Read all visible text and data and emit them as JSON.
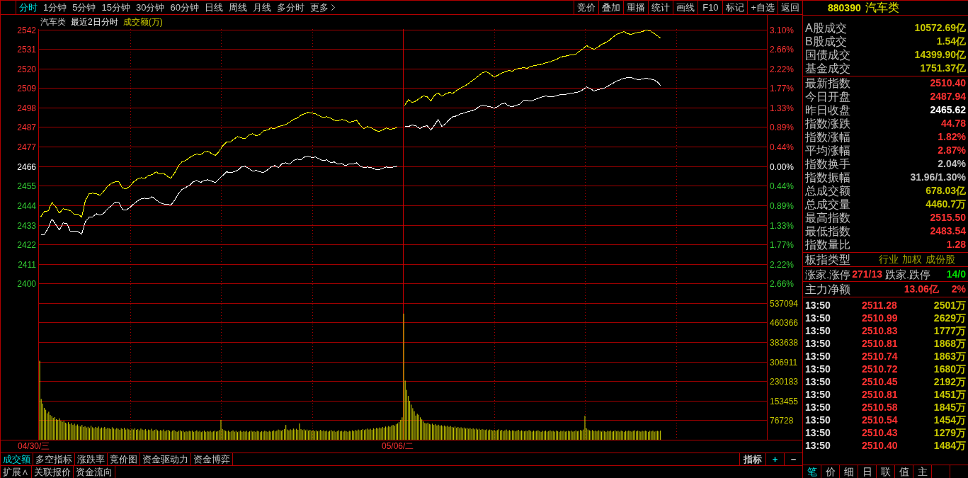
{
  "toolbar": {
    "periods": [
      {
        "label": "分时",
        "selected": true
      },
      {
        "label": "1分钟",
        "selected": false
      },
      {
        "label": "5分钟",
        "selected": false
      },
      {
        "label": "15分钟",
        "selected": false
      },
      {
        "label": "30分钟",
        "selected": false
      },
      {
        "label": "60分钟",
        "selected": false
      },
      {
        "label": "日线",
        "selected": false
      },
      {
        "label": "周线",
        "selected": false
      },
      {
        "label": "月线",
        "selected": false
      },
      {
        "label": "多分时",
        "selected": false
      }
    ],
    "more": "更多",
    "tools": [
      "竞价",
      "叠加",
      "重播",
      "统计",
      "画线",
      "F10",
      "标记",
      "+自选",
      "返回"
    ]
  },
  "chart": {
    "header": {
      "name": "汽车类",
      "mode": "最近2日分时",
      "indicator": "成交额(万)"
    },
    "price_chart": {
      "chart_data": {
        "type": "line",
        "grid": true,
        "categories": [
          null,
          null,
          null,
          null,
          null,
          null,
          null,
          null,
          null,
          null,
          null,
          null,
          null,
          null,
          null,
          null,
          null,
          null,
          null,
          null,
          null,
          null,
          null,
          null,
          null,
          null,
          null,
          null,
          null,
          null,
          null,
          null,
          null,
          null,
          null,
          null,
          null,
          null,
          null,
          null,
          null,
          null,
          null,
          null,
          null,
          null,
          null,
          null,
          null,
          null,
          null,
          null,
          null,
          null,
          null,
          null,
          null,
          null,
          null,
          null,
          null,
          null,
          null,
          null,
          null,
          null,
          null,
          null,
          null,
          null,
          null,
          null,
          null,
          null,
          null,
          null,
          null,
          null,
          null,
          null,
          null,
          null,
          null,
          null,
          null,
          null,
          null,
          null,
          null,
          null,
          null,
          null,
          null,
          null,
          null,
          null,
          null,
          null,
          null,
          null,
          null,
          null,
          null,
          null,
          null,
          null,
          null,
          null,
          null,
          null,
          null,
          null,
          null,
          null,
          null,
          null,
          null,
          null,
          null,
          null,
          null,
          null,
          null,
          null,
          null,
          null,
          null,
          null,
          null,
          null,
          null,
          null,
          null,
          null,
          null,
          null,
          null,
          null,
          null,
          null,
          null,
          null,
          null,
          null,
          null,
          null,
          null,
          null,
          null,
          null,
          null,
          null,
          null,
          null,
          null,
          null,
          null,
          null,
          null,
          null,
          null,
          null,
          null,
          null,
          null,
          null,
          null,
          null,
          null,
          null,
          null,
          null,
          null,
          null,
          null,
          null,
          null,
          null,
          null,
          null,
          null,
          null,
          null,
          null,
          null,
          null,
          null,
          null,
          null,
          null,
          null,
          null,
          null,
          null,
          null,
          null
        ],
        "series": [
          {
            "color": "#ffffff",
            "values": [
              2427.6,
              2427.6,
              2431.2,
              2436.3,
              2433.2,
              2430.0,
              2434.0,
              2433.6,
              2429.2,
              2429.2,
              2429.2,
              2427.6,
              2434.8,
              2437.1,
              2437.5,
              2439.1,
              2438.3,
              2439.5,
              2441.9,
              2443.5,
              2445.4,
              2445.4,
              2441.5,
              2441.1,
              2442.7,
              2444.6,
              2446.2,
              2447.4,
              2447.8,
              2447.4,
              2448.6,
              2447.0,
              2445.4,
              2444.6,
              2444.6,
              2443.9,
              2446.6,
              2450.2,
              2452.6,
              2453.8,
              2454.9,
              2456.9,
              2457.7,
              2456.5,
              2457.7,
              2458.1,
              2457.3,
              2456.5,
              2458.5,
              2460.5,
              2462.5,
              2462.1,
              2462.5,
              2463.3,
              2465.2,
              2465.6,
              2464.4,
              2462.9,
              2463.3,
              2462.5,
              2462.1,
              2463.6,
              2465.2,
              2466.0,
              2464.8,
              2467.2,
              2467.6,
              2466.8,
              2468.8,
              2469.6,
              2469.2,
              2470.8,
              2471.2,
              2470.4,
              2470.8,
              2469.6,
              2468.8,
              2469.2,
              2467.6,
              2468.0,
              2466.8,
              2467.2,
              2466.0,
              2466.8,
              2466.8,
              2467.6,
              2465.6,
              2464.8,
              2465.2,
              2464.8,
              2464.0,
              2463.6,
              2464.4,
              2465.2,
              2464.8,
              2465.2,
              2465.6,
              null,
              2487.8,
              2487.8,
              2488.6,
              2488.2,
              2486.6,
              2487.8,
              2488.2,
              2485.8,
              2488.6,
              2491.7,
              2487.8,
              2489.4,
              2491.7,
              2493.3,
              2493.7,
              2494.9,
              2495.3,
              2496.1,
              2496.5,
              2497.3,
              2498.9,
              2499.6,
              2499.2,
              2498.9,
              2498.1,
              2498.9,
              2500.4,
              2500.8,
              2499.2,
              2498.9,
              2499.6,
              2500.4,
              2502.4,
              2502.4,
              2502.0,
              2502.8,
              2503.6,
              2504.4,
              2504.8,
              2504.4,
              2504.4,
              2505.2,
              2505.6,
              2505.6,
              2506.0,
              2506.4,
              2506.8,
              2507.2,
              2508.4,
              2509.9,
              2508.8,
              2507.6,
              2508.4,
              2508.8,
              2509.5,
              2510.7,
              2511.9,
              2513.1,
              2513.9,
              2514.7,
              2515.1,
              2515.1,
              2514.3,
              2513.9,
              2514.3,
              2514.7,
              2514.3,
              2513.9,
              2512.7,
              2510.4,
              null,
              null,
              null,
              null,
              null,
              null,
              null,
              null,
              null,
              null,
              null,
              null,
              null,
              null,
              null,
              null,
              null,
              null,
              null,
              null,
              null,
              null,
              null,
              null,
              null,
              null,
              null,
              null
            ]
          },
          {
            "color": "#ffff00",
            "values": [
              2437.5,
              2440.3,
              2440.7,
              2445.4,
              2443.1,
              2439.5,
              2441.9,
              2441.5,
              2440.7,
              2438.7,
              2439.1,
              2437.1,
              2446.6,
              2450.2,
              2450.6,
              2450.2,
              2449.4,
              2451.8,
              2454.5,
              2456.1,
              2456.9,
              2456.9,
              2453.4,
              2453.0,
              2454.5,
              2456.9,
              2458.5,
              2459.3,
              2458.9,
              2460.5,
              2460.9,
              2462.5,
              2461.3,
              2461.7,
              2460.1,
              2458.9,
              2461.7,
              2465.6,
              2468.0,
              2468.8,
              2470.4,
              2471.6,
              2472.4,
              2472.0,
              2473.5,
              2473.9,
              2472.7,
              2471.6,
              2473.9,
              2477.1,
              2479.1,
              2479.1,
              2480.7,
              2482.2,
              2481.4,
              2481.1,
              2483.0,
              2483.8,
              2482.6,
              2483.4,
              2485.4,
              2485.8,
              2487.0,
              2486.6,
              2487.8,
              2488.2,
              2489.0,
              2490.2,
              2491.7,
              2492.5,
              2494.1,
              2494.9,
              2495.7,
              2495.3,
              2494.9,
              2493.7,
              2492.9,
              2493.3,
              2492.5,
              2491.3,
              2490.9,
              2491.7,
              2491.3,
              2490.2,
              2490.6,
              2491.3,
              2488.6,
              2486.6,
              2487.8,
              2487.0,
              2485.8,
              2485.0,
              2485.8,
              2487.0,
              2486.2,
              2486.6,
              2487.4,
              null,
              2499.6,
              2502.8,
              2501.2,
              2502.0,
              2503.6,
              2504.8,
              2504.4,
              2502.0,
              2505.2,
              2506.4,
              2504.8,
              2506.0,
              2506.8,
              2506.4,
              2508.0,
              2509.2,
              2510.3,
              2511.5,
              2513.1,
              2514.7,
              2516.3,
              2517.9,
              2518.3,
              2517.1,
              2515.5,
              2516.3,
              2517.5,
              2518.3,
              2519.1,
              2518.7,
              2519.9,
              2520.3,
              2520.6,
              2520.3,
              2521.4,
              2521.8,
              2522.2,
              2522.6,
              2523.4,
              2523.8,
              2524.6,
              2525.4,
              2526.6,
              2527.0,
              2527.4,
              2527.8,
              2528.1,
              2529.7,
              2531.3,
              2532.9,
              2531.7,
              2530.9,
              2532.1,
              2533.7,
              2534.5,
              2535.7,
              2537.6,
              2539.2,
              2540.0,
              2540.8,
              2539.6,
              2539.2,
              2540.0,
              2540.4,
              2540.8,
              2541.6,
              2541.2,
              2540.0,
              2538.4,
              2536.9,
              null,
              null,
              null,
              null,
              null,
              null,
              null,
              null,
              null,
              null,
              null,
              null,
              null,
              null,
              null,
              null,
              null,
              null,
              null,
              null,
              null,
              null,
              null,
              null,
              null,
              null,
              null,
              null
            ]
          }
        ],
        "ylim": [
          2400.2,
          2542.0
        ],
        "yticks": [
          {
            "value": 2542.0,
            "label": "2542"
          },
          {
            "value": 2531.1,
            "label": "2531"
          },
          {
            "value": 2520.2,
            "label": "2520"
          },
          {
            "value": 2509.3,
            "label": "2509"
          },
          {
            "value": 2498.4,
            "label": "2498"
          },
          {
            "value": 2487.5,
            "label": "2487"
          },
          {
            "value": 2476.5,
            "label": "2477"
          },
          {
            "value": 2465.6,
            "label": "2466"
          },
          {
            "value": 2454.7,
            "label": "2455"
          },
          {
            "value": 2443.8,
            "label": "2444"
          },
          {
            "value": 2432.9,
            "label": "2433"
          },
          {
            "value": 2422.0,
            "label": "2422"
          },
          {
            "value": 2411.1,
            "label": "2411"
          },
          {
            "value": 2400.2,
            "label": "2400"
          }
        ]
      },
      "percent_labels": [
        {
          "label": "3.10%",
          "color": "#ff3232"
        },
        {
          "label": "2.66%",
          "color": "#ff3232"
        },
        {
          "label": "2.22%",
          "color": "#ff3232"
        },
        {
          "label": "1.77%",
          "color": "#ff3232"
        },
        {
          "label": "1.33%",
          "color": "#ff3232"
        },
        {
          "label": "0.89%",
          "color": "#ff3232"
        },
        {
          "label": "0.44%",
          "color": "#ff3232"
        },
        {
          "label": "0.00%",
          "color": "#ffffff"
        },
        {
          "label": "0.44%",
          "color": "#33cc33"
        },
        {
          "label": "0.89%",
          "color": "#33cc33"
        },
        {
          "label": "1.33%",
          "color": "#33cc33"
        },
        {
          "label": "1.77%",
          "color": "#33cc33"
        },
        {
          "label": "2.22%",
          "color": "#33cc33"
        },
        {
          "label": "2.66%",
          "color": "#33cc33"
        }
      ]
    },
    "volume_chart": {
      "chart_data": {
        "type": "bar",
        "grid": true,
        "categories": [
          null,
          null,
          null,
          null,
          null,
          null,
          null,
          null,
          null,
          null,
          null,
          null,
          null,
          null,
          null,
          null,
          null,
          null,
          null,
          null,
          null,
          null,
          null,
          null,
          null,
          null,
          null,
          null,
          null,
          null,
          null,
          null,
          null,
          null,
          null,
          null,
          null,
          null,
          null,
          null,
          null,
          null,
          null,
          null,
          null,
          null,
          null,
          null,
          null,
          null,
          null,
          null,
          null,
          null,
          null,
          null,
          null,
          null,
          null,
          null,
          null,
          null,
          null,
          null,
          null,
          null,
          null,
          null,
          null,
          null,
          null,
          null,
          null,
          null,
          null,
          null,
          null,
          null,
          null,
          null,
          null,
          null,
          null,
          null,
          null,
          null,
          null,
          null,
          null,
          null,
          null,
          null,
          null,
          null,
          null,
          null,
          null,
          null,
          null,
          null,
          null,
          null,
          null,
          null,
          null,
          null,
          null,
          null,
          null,
          null,
          null,
          null,
          null,
          null,
          null,
          null,
          null,
          null,
          null,
          null,
          null,
          null,
          null,
          null,
          null,
          null,
          null,
          null,
          null,
          null,
          null,
          null,
          null,
          null,
          null,
          null,
          null,
          null,
          null,
          null,
          null,
          null,
          null,
          null,
          null,
          null,
          null,
          null,
          null,
          null,
          null,
          null,
          null,
          null,
          null,
          null,
          null,
          null,
          null,
          null,
          null,
          null,
          null,
          null,
          null,
          null,
          null,
          null,
          null,
          null,
          null,
          null,
          null,
          null,
          null,
          null,
          null,
          null,
          null,
          null,
          null,
          null,
          null,
          null,
          null,
          null,
          null,
          null,
          null,
          null,
          null,
          null,
          null,
          null,
          null,
          null,
          null,
          null,
          null,
          null,
          null,
          null,
          null,
          null,
          null,
          null,
          null,
          null,
          null,
          null,
          null,
          null,
          null,
          null,
          null,
          null,
          null,
          null,
          null,
          null,
          null,
          null,
          null,
          null,
          null,
          null,
          null,
          null,
          null,
          null,
          null,
          null,
          null,
          null,
          null,
          null,
          null,
          null,
          null,
          null,
          null,
          null,
          null,
          null,
          null,
          null,
          null,
          null,
          null,
          null,
          null,
          null,
          null,
          null,
          null,
          null,
          null,
          null,
          null,
          null,
          null,
          null,
          null,
          null,
          null,
          null,
          null,
          null,
          null,
          null,
          null,
          null,
          null,
          null,
          null,
          null,
          null,
          null,
          null,
          null,
          null,
          null,
          null,
          null,
          null,
          null,
          null,
          null,
          null,
          null,
          null,
          null,
          null,
          null,
          null,
          null,
          null,
          null,
          null,
          null,
          null,
          null,
          null,
          null,
          null,
          null,
          null,
          null,
          null,
          null,
          null,
          null,
          null,
          null,
          null,
          null,
          null,
          null,
          null,
          null,
          null,
          null,
          null,
          null,
          null,
          null,
          null,
          null,
          null,
          null,
          null,
          null,
          null,
          null,
          null,
          null,
          null,
          null,
          null,
          null,
          null,
          null,
          null,
          null,
          null,
          null,
          null,
          null,
          null,
          null,
          null,
          null,
          null,
          null,
          null,
          null,
          null,
          null,
          null,
          null,
          null,
          null,
          null,
          null,
          null,
          null,
          null,
          null,
          null,
          null,
          null,
          null,
          null,
          null,
          null,
          null,
          null,
          null,
          null,
          null,
          null,
          null,
          null,
          null,
          null,
          null,
          null,
          null,
          null,
          null,
          null,
          null,
          null,
          null,
          null,
          null,
          null,
          null,
          null,
          null,
          null,
          null,
          null,
          null,
          null,
          null,
          null,
          null,
          null,
          null,
          null,
          null,
          null,
          null,
          null,
          null,
          null,
          null,
          null,
          null,
          null,
          null,
          null,
          null,
          null,
          null,
          null,
          null,
          null,
          null,
          null,
          null,
          null,
          null,
          null,
          null,
          null,
          null,
          null,
          null,
          null,
          null,
          null,
          null,
          null,
          null,
          null,
          null,
          null,
          null,
          null,
          null,
          null,
          null,
          null,
          null,
          null,
          null,
          null,
          null,
          null,
          null,
          null,
          null,
          null,
          null,
          null,
          null,
          null,
          null,
          null,
          null,
          null,
          null,
          null,
          null,
          null,
          null,
          null,
          null,
          null,
          null
        ],
        "ylim": [
          0,
          537094
        ],
        "yticks": [
          537094,
          460366,
          383638,
          306911,
          230183,
          153455,
          76728
        ],
        "series": [
          {
            "color": "#c8c800",
            "values": [
              310000,
              160000,
              142000,
              125000,
              118000,
              104000,
              110000,
              97000,
              93000,
              86000,
              89000,
              81000,
              78000,
              84000,
              75000,
              71000,
              74000,
              67000,
              64000,
              69000,
              61000,
              65000,
              58000,
              63000,
              56000,
              60000,
              54000,
              52000,
              58000,
              50000,
              53000,
              48000,
              51000,
              46000,
              55000,
              49000,
              45000,
              50000,
              47000,
              52000,
              44000,
              48000,
              46000,
              50000,
              43000,
              47000,
              45000,
              42000,
              49000,
              44000,
              41000,
              46000,
              43000,
              39000,
              45000,
              42000,
              47000,
              40000,
              44000,
              41000,
              38000,
              43000,
              40000,
              45000,
              39000,
              42000,
              37000,
              44000,
              40000,
              38000,
              42000,
              36000,
              40000,
              38000,
              43000,
              35000,
              39000,
              41000,
              37000,
              34000,
              38000,
              36000,
              40000,
              33000,
              37000,
              39000,
              35000,
              32000,
              36000,
              38000,
              34000,
              31000,
              35000,
              37000,
              33000,
              36000,
              30000,
              34000,
              32000,
              35000,
              33000,
              36000,
              31000,
              34000,
              37000,
              32000,
              35000,
              30000,
              33000,
              36000,
              31000,
              34000,
              32000,
              35000,
              30000,
              33000,
              36000,
              32000,
              34000,
              38000,
              78000,
              42000,
              38000,
              35000,
              33000,
              36000,
              31000,
              34000,
              37000,
              32000,
              35000,
              30000,
              33000,
              36000,
              31000,
              34000,
              32000,
              35000,
              30000,
              33000,
              36000,
              32000,
              34000,
              31000,
              35000,
              33000,
              30000,
              34000,
              32000,
              36000,
              33000,
              31000,
              35000,
              32000,
              34000,
              37000,
              33000,
              36000,
              40000,
              38000,
              35000,
              39000,
              42000,
              58000,
              40000,
              37000,
              41000,
              38000,
              44000,
              40000,
              43000,
              39000,
              64000,
              42000,
              38000,
              41000,
              37000,
              40000,
              36000,
              39000,
              35000,
              38000,
              34000,
              37000,
              33000,
              36000,
              39000,
              34000,
              37000,
              33000,
              36000,
              32000,
              35000,
              38000,
              33000,
              36000,
              31000,
              34000,
              37000,
              33000,
              35000,
              32000,
              36000,
              34000,
              31000,
              35000,
              33000,
              37000,
              34000,
              38000,
              36000,
              40000,
              37000,
              39000,
              42000,
              38000,
              41000,
              44000,
              40000,
              43000,
              39000,
              45000,
              42000,
              47000,
              44000,
              48000,
              45000,
              50000,
              47000,
              52000,
              49000,
              54000,
              51000,
              56000,
              58000,
              55000,
              61000,
              64000,
              70000,
              78000,
              88000,
              495000,
              232000,
              196000,
              172000,
              153000,
              138000,
              124000,
              112000,
              95000,
              102000,
              98000,
              88000,
              80000,
              72000,
              66000,
              64000,
              67000,
              62000,
              60000,
              63000,
              58000,
              61000,
              56000,
              59000,
              55000,
              57000,
              53000,
              56000,
              52000,
              55000,
              51000,
              54000,
              50000,
              48000,
              52000,
              47000,
              50000,
              46000,
              49000,
              45000,
              48000,
              44000,
              47000,
              43000,
              46000,
              42000,
              45000,
              41000,
              44000,
              40000,
              43000,
              39000,
              42000,
              40000,
              38000,
              41000,
              37000,
              40000,
              39000,
              36000,
              39000,
              35000,
              38000,
              41000,
              36000,
              39000,
              34000,
              37000,
              40000,
              35000,
              38000,
              34000,
              37000,
              36000,
              33000,
              36000,
              39000,
              34000,
              37000,
              35000,
              33000,
              36000,
              34000,
              38000,
              35000,
              32000,
              36000,
              33000,
              35000,
              37000,
              34000,
              31000,
              35000,
              33000,
              36000,
              32000,
              34000,
              37000,
              33000,
              35000,
              32000,
              36000,
              34000,
              31000,
              35000,
              33000,
              36000,
              32000,
              34000,
              35000,
              33000,
              36000,
              32000,
              34000,
              37000,
              33000,
              35000,
              38000,
              36000,
              40000,
              94000,
              45000,
              40000,
              37000,
              35000,
              38000,
              34000,
              36000,
              33000,
              37000,
              35000,
              32000,
              36000,
              34000,
              31000,
              35000,
              33000,
              36000,
              32000,
              34000,
              37000,
              33000,
              35000,
              32000,
              36000,
              34000,
              31000,
              35000,
              33000,
              36000,
              34000,
              32000,
              35000,
              37000,
              33000,
              36000,
              34000,
              32000,
              35000,
              33000,
              36000,
              34000,
              31000,
              35000,
              33000,
              36000,
              32000,
              34000,
              35000,
              33000,
              36000,
              null,
              null,
              null,
              null,
              null,
              null,
              null,
              null,
              null,
              null,
              null,
              null,
              null,
              null,
              null,
              null,
              null,
              null,
              null,
              null,
              null,
              null,
              null,
              null,
              null,
              null,
              null,
              null,
              null,
              null,
              null,
              null,
              null,
              null,
              null,
              null,
              null,
              null,
              null,
              null,
              null,
              null,
              null,
              null,
              null,
              null,
              null,
              null,
              null,
              null,
              null,
              null,
              null,
              null,
              null,
              null,
              null,
              null,
              null,
              null,
              null,
              null,
              null,
              null,
              null,
              null,
              null,
              null,
              null,
              null
            ]
          }
        ]
      }
    },
    "date_labels": [
      "04/30/三",
      "05/06/二"
    ]
  },
  "indicator_tabs": [
    {
      "label": "成交额",
      "selected": true
    },
    {
      "label": "多空指标",
      "selected": false
    },
    {
      "label": "涨跌率",
      "selected": false
    },
    {
      "label": "竞价图",
      "selected": false
    },
    {
      "label": "资金驱动力",
      "selected": false
    },
    {
      "label": "资金博弈",
      "selected": false
    }
  ],
  "indicator_controls": [
    {
      "label": "指标",
      "color": "#c8c8c8"
    },
    {
      "label": "+",
      "color": "#00e0e0"
    },
    {
      "label": "−",
      "color": "#c8c8c8"
    }
  ],
  "bottom_tabs": [
    "扩展∧",
    "关联报价",
    "资金流向"
  ],
  "panel": {
    "quote_header": {
      "code": "880390",
      "name": "汽车类"
    },
    "market_turnover": [
      {
        "label": "A股成交",
        "value": "10572.69亿"
      },
      {
        "label": "B股成交",
        "value": "1.54亿"
      },
      {
        "label": "国债成交",
        "value": "14399.90亿"
      },
      {
        "label": "基金成交",
        "value": "1751.37亿"
      }
    ],
    "index_stats": [
      {
        "label": "最新指数",
        "value": "2510.40",
        "color": "#ff3232"
      },
      {
        "label": "今日开盘",
        "value": "2487.94",
        "color": "#ff3232"
      },
      {
        "label": "昨日收盘",
        "value": "2465.62",
        "color": "#ffffff"
      },
      {
        "label": "指数涨跌",
        "value": "44.78",
        "color": "#ff3232"
      },
      {
        "label": "指数涨幅",
        "value": "1.82%",
        "color": "#ff3232"
      },
      {
        "label": "平均涨幅",
        "value": "2.87%",
        "color": "#ff3232"
      },
      {
        "label": "指数换手",
        "value": "2.04%",
        "color": "#c0c0c0"
      },
      {
        "label": "指数振幅",
        "value": "31.96/1.30%",
        "color": "#c0c0c0"
      },
      {
        "label": "总成交额",
        "value": "678.03亿",
        "color": "#c8c800"
      },
      {
        "label": "总成交量",
        "value": "4460.7万",
        "color": "#c8c800"
      },
      {
        "label": "最高指数",
        "value": "2515.50",
        "color": "#ff3232"
      },
      {
        "label": "最低指数",
        "value": "2483.54",
        "color": "#ff3232"
      },
      {
        "label": "指数量比",
        "value": "1.28",
        "color": "#ff3232"
      }
    ],
    "sector_type": {
      "label": "板指类型",
      "values": [
        "行业",
        "加权",
        "成份股"
      ]
    },
    "breadth": {
      "up_label": "涨家.涨停",
      "up_value": "271/13",
      "down_label": "跌家.跌停",
      "down_value": "14/0"
    },
    "main_net": {
      "label": "主力净额",
      "amount": "13.06亿",
      "ratio": "2%"
    },
    "ticks": [
      {
        "time": "13:50",
        "price": "2511.28",
        "volume": "2501万"
      },
      {
        "time": "13:50",
        "price": "2510.99",
        "volume": "2629万"
      },
      {
        "time": "13:50",
        "price": "2510.83",
        "volume": "1777万"
      },
      {
        "time": "13:50",
        "price": "2510.81",
        "volume": "1868万"
      },
      {
        "time": "13:50",
        "price": "2510.74",
        "volume": "1863万"
      },
      {
        "time": "13:50",
        "price": "2510.72",
        "volume": "1680万"
      },
      {
        "time": "13:50",
        "price": "2510.45",
        "volume": "2192万"
      },
      {
        "time": "13:50",
        "price": "2510.81",
        "volume": "1451万"
      },
      {
        "time": "13:50",
        "price": "2510.58",
        "volume": "1845万"
      },
      {
        "time": "13:50",
        "price": "2510.54",
        "volume": "1454万"
      },
      {
        "time": "13:50",
        "price": "2510.43",
        "volume": "1279万"
      },
      {
        "time": "13:50",
        "price": "2510.40",
        "volume": "1484万"
      }
    ],
    "panel_tabs": [
      {
        "label": "笔",
        "selected": true
      },
      {
        "label": "价",
        "selected": false
      },
      {
        "label": "细",
        "selected": false
      },
      {
        "label": "日",
        "selected": false
      },
      {
        "label": "联",
        "selected": false
      },
      {
        "label": "值",
        "selected": false
      },
      {
        "label": "主",
        "selected": false
      }
    ]
  }
}
